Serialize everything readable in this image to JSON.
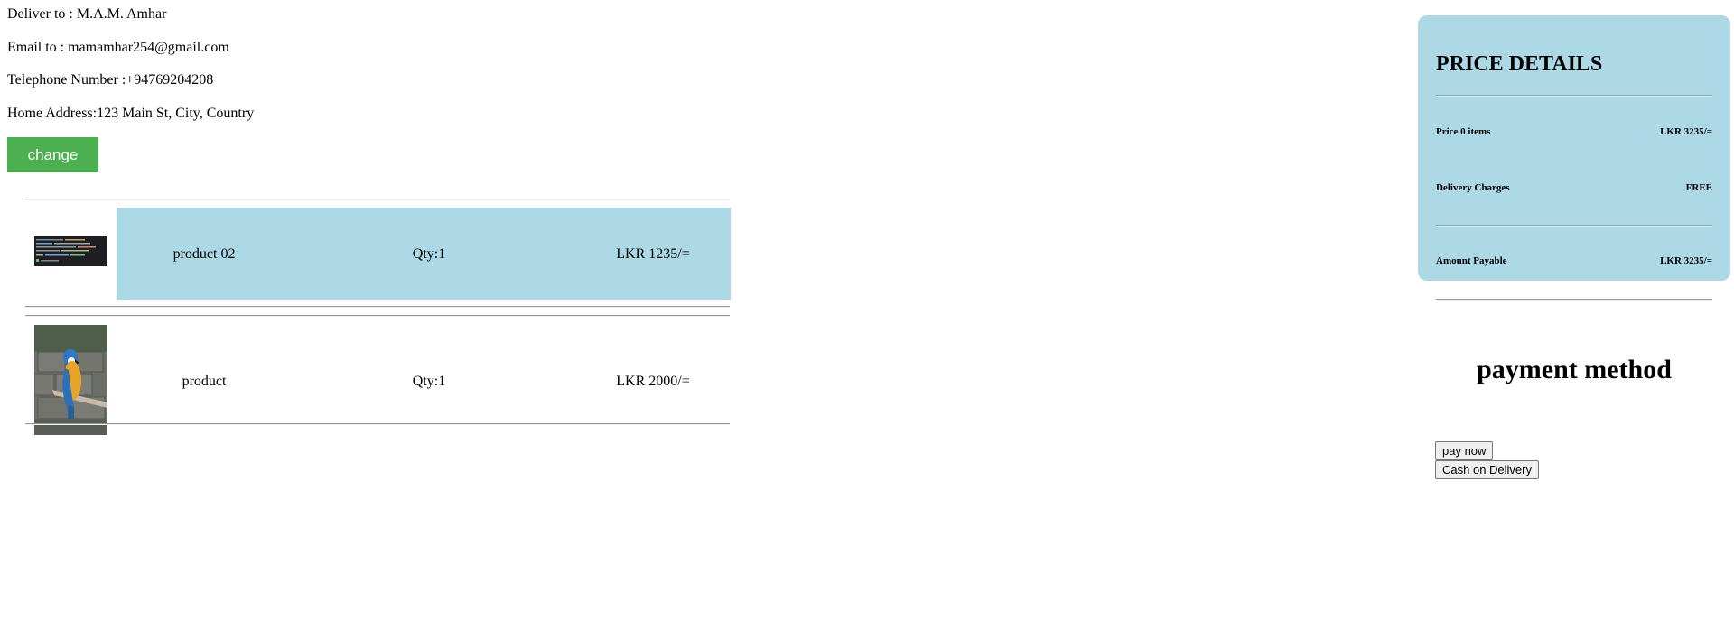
{
  "customer": {
    "deliver_to": "Deliver to : M.A.M. Amhar",
    "email": "Email to : mamamhar254@gmail.com",
    "telephone": "Telephone Number :+94769204208",
    "address": "Home Address:123 Main St, City, Country",
    "change_label": "change"
  },
  "cart": {
    "items": [
      {
        "name": "product 02",
        "qty": "Qty:1",
        "price": "LKR 1235/=",
        "thumbnail": "code-editor-screenshot-thumbnail",
        "highlighted": true
      },
      {
        "name": "product",
        "qty": "Qty:1",
        "price": "LKR 2000/=",
        "thumbnail": "parrot-photo-thumbnail",
        "highlighted": false
      }
    ]
  },
  "price_details": {
    "title": "PRICE DETAILS",
    "rows": [
      {
        "label": "Price 0 items",
        "value": "LKR 3235/="
      },
      {
        "label": "Delivery Charges",
        "value": "FREE"
      },
      {
        "label": "Amount Payable",
        "value": "LKR 3235/="
      }
    ]
  },
  "payment": {
    "title": "payment method",
    "pay_now_label": "pay now",
    "cod_label": "Cash on Delivery"
  },
  "colors": {
    "accent_green": "#4caf50",
    "highlight_blue": "#add8e6"
  }
}
